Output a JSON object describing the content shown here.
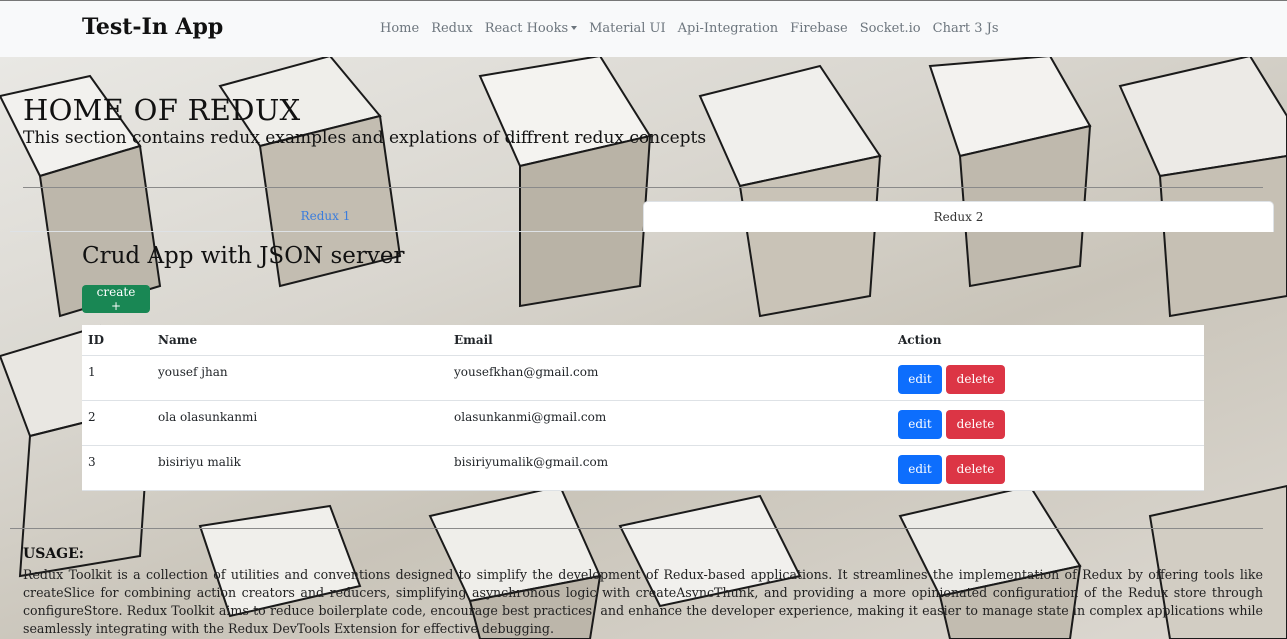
{
  "navbar": {
    "brand": "Test-In App",
    "links": [
      "Home",
      "Redux",
      "React Hooks",
      "Material UI",
      "Api-Integration",
      "Firebase",
      "Socket.io",
      "Chart 3 Js"
    ]
  },
  "hero": {
    "title": "HOME OF REDUX",
    "subtitle": "This section contains redux examples and explations of diffrent redux concepts"
  },
  "tabs": [
    {
      "label": "Redux 1",
      "active": false
    },
    {
      "label": "Redux 2",
      "active": true
    }
  ],
  "crud": {
    "title": "Crud App with JSON server",
    "create_label": "create +",
    "columns": [
      "ID",
      "Name",
      "Email",
      "Action"
    ],
    "rows": [
      {
        "id": "1",
        "name": "yousef jhan",
        "email": "yousefkhan@gmail.com"
      },
      {
        "id": "2",
        "name": "ola olasunkanmi",
        "email": "olasunkanmi@gmail.com"
      },
      {
        "id": "3",
        "name": "bisiriyu malik",
        "email": "bisiriyumalik@gmail.com"
      }
    ],
    "edit_label": "edit",
    "delete_label": "delete"
  },
  "usage": {
    "title": "USAGE:",
    "text": "Redux Toolkit is a collection of utilities and conventions designed to simplify the development of Redux-based applications. It streamlines the implementation of Redux by offering tools like createSlice for combining action creators and reducers, simplifying asynchronous logic with createAsyncThunk, and providing a more opinionated configuration of the Redux store through configureStore. Redux Toolkit aims to reduce boilerplate code, encourage best practices, and enhance the developer experience, making it easier to manage state in complex applications while seamlessly integrating with the Redux DevTools Extension for effective debugging."
  },
  "colors": {
    "create": "#198754",
    "edit": "#0d6efd",
    "delete": "#dc3545",
    "tab_active_link": "#3b7ddd"
  }
}
